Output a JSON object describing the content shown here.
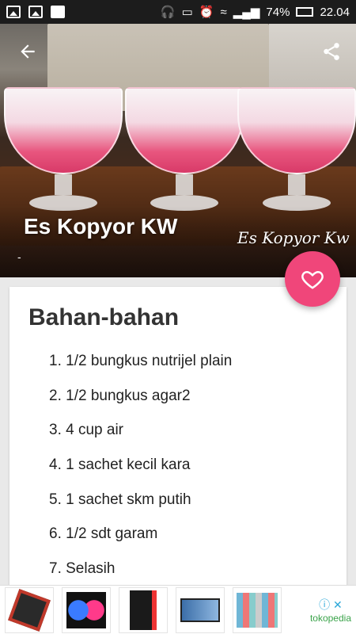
{
  "status_bar": {
    "battery": "74%",
    "time": "22.04"
  },
  "recipe": {
    "title": "Es Kopyor KW",
    "subtitle": "-",
    "watermark": "Es Kopyor Kw",
    "section_heading": "Bahan-bahan",
    "ingredients": [
      "1/2 bungkus nutrijel plain",
      "1/2 bungkus agar2",
      "4 cup air",
      "1 sachet kecil kara",
      "1 sachet skm putih",
      "1/2 sdt garam",
      "Selasih"
    ]
  },
  "ad": {
    "brand": "tokopedia",
    "info_icon": "info-icon",
    "close_icon": "close-icon"
  },
  "colors": {
    "accent": "#f0467a",
    "status_bar": "#1c1c1c",
    "ad_brand": "#3aa34a"
  }
}
